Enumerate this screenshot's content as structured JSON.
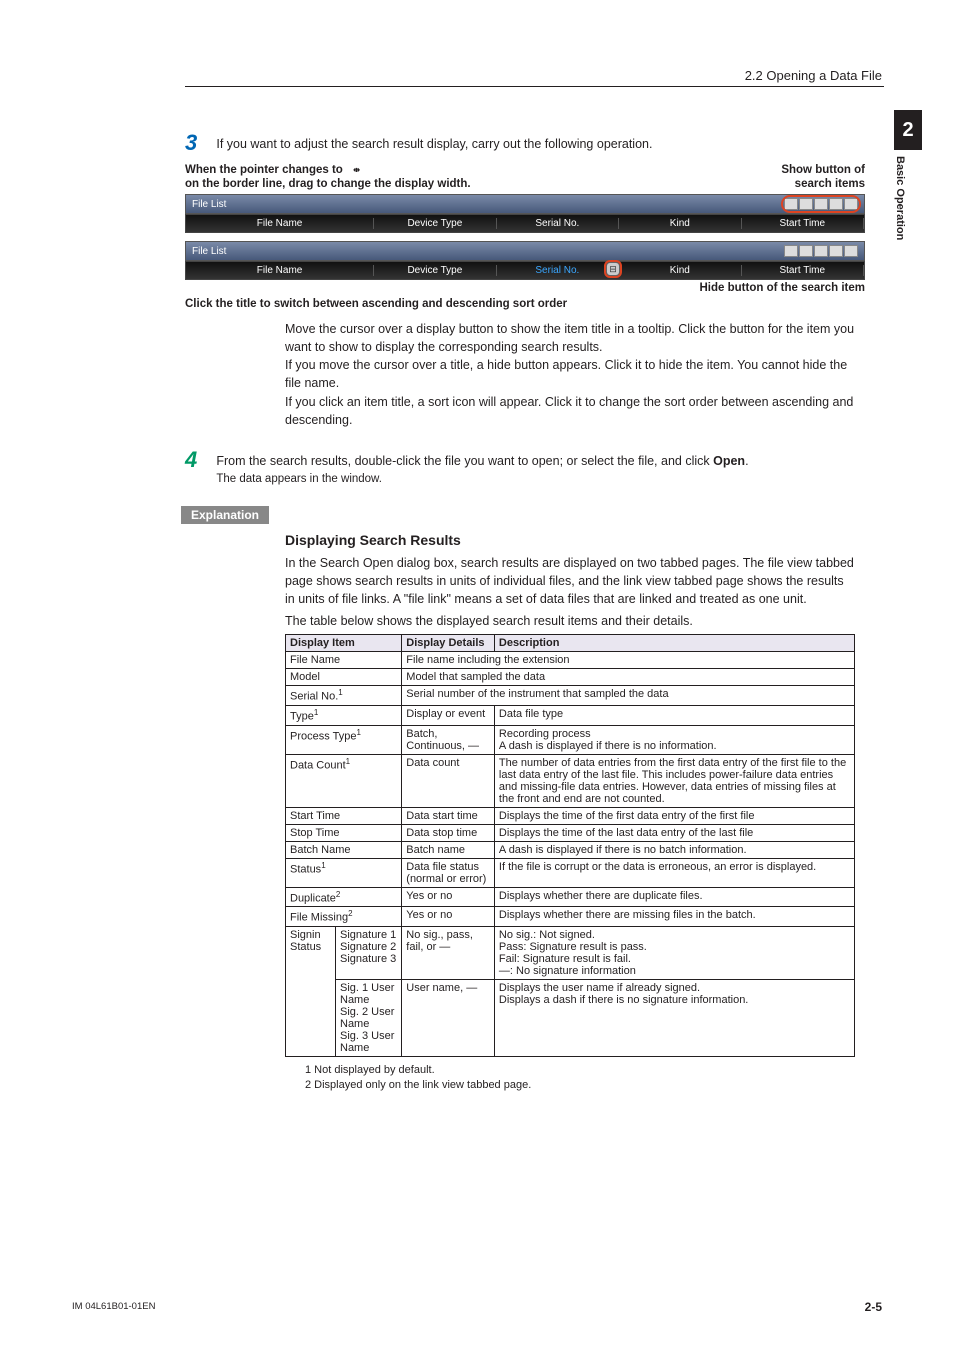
{
  "header": {
    "section": "2.2  Opening a Data File"
  },
  "sidebar": {
    "chapter_num": "2",
    "chapter_label": "Basic Operation"
  },
  "step3": {
    "num": "3",
    "text": "If you want to adjust the search result display, carry out the following operation.",
    "ann_left_l1": "When the pointer changes to",
    "ann_left_l2": "on the border line, drag to change the display width.",
    "ann_right_l1": "Show button of",
    "ann_right_l2": "search items",
    "file_list_label": "File List",
    "hdr": {
      "c1": "File Name",
      "c2": "Device Type",
      "c3": "Serial No.",
      "c4": "Kind",
      "c5": "Start Time"
    },
    "hide_caption": "Hide button of the search item",
    "sort_caption": "Click the title to switch between ascending and descending sort order",
    "para1": "Move the cursor over a display button to show the item title in a tooltip. Click the button for the item you want to show to display the corresponding search results.",
    "para2": "If you move the cursor over a title, a hide button appears. Click it to hide the item. You cannot hide the file name.",
    "para3": "If you click an item title, a sort icon will appear. Click it to change the sort order between ascending and descending."
  },
  "step4": {
    "num": "4",
    "text_a": "From the search results, double-click the file you want to open; or select the file, and click ",
    "text_b": "Open",
    "text_c": ".",
    "sub": "The data appears in the window."
  },
  "explanation": {
    "label": "Explanation",
    "title": "Displaying Search Results",
    "body1": "In the Search Open dialog box, search results are displayed on two tabbed pages. The file view tabbed page shows search results in units of individual files, and the link view tabbed page shows the results in units of file links. A \"file link\" means a set of data files that are linked and treated as one unit.",
    "body2": "The table below shows the displayed search result items and their details."
  },
  "table": {
    "head": {
      "c1": "Display Item",
      "c2": "Display Details",
      "c3": "Description"
    },
    "rows": [
      {
        "item": "File Name",
        "sup": "",
        "det": "File name including the extension",
        "desc": "",
        "span2": true
      },
      {
        "item": "Model",
        "sup": "",
        "det": "Model that sampled the data",
        "desc": "",
        "span2": true
      },
      {
        "item": "Serial No.",
        "sup": "1",
        "det": "Serial number of the instrument that sampled the data",
        "desc": "",
        "span2": true
      },
      {
        "item": "Type",
        "sup": "1",
        "det": "Display or event",
        "desc": "Data file type"
      },
      {
        "item": "Process Type",
        "sup": "1",
        "det": "Batch, Continuous, —",
        "desc": "Recording process\nA dash is displayed if there is no information."
      },
      {
        "item": "Data Count",
        "sup": "1",
        "det": "Data count",
        "desc": "The number of data entries from the first data entry of the first file to the last data entry of the last file. This includes power-failure data entries and missing-file data entries. However, data entries of missing files at the front and end are not counted."
      },
      {
        "item": "Start Time",
        "sup": "",
        "det": "Data start time",
        "desc": "Displays the time of the first data entry of the first file"
      },
      {
        "item": "Stop Time",
        "sup": "",
        "det": "Data stop time",
        "desc": "Displays the time of the last data entry of the last file"
      },
      {
        "item": "Batch Name",
        "sup": "",
        "det": "Batch name",
        "desc": "A dash is displayed if there is no batch information."
      },
      {
        "item": "Status",
        "sup": "1",
        "det": "Data file status (normal or error)",
        "desc": "If the file is corrupt or the data is erroneous, an error is displayed."
      },
      {
        "item": "Duplicate",
        "sup": "2",
        "det": "Yes or no",
        "desc": "Displays whether there are duplicate files."
      },
      {
        "item": "File Missing",
        "sup": "2",
        "det": "Yes or no",
        "desc": "Displays whether there are missing files in the batch."
      }
    ],
    "signin_row": {
      "left": "Signin Status",
      "sub1_item": "Signature 1\nSignature 2\nSignature 3",
      "sub1_det": "No sig., pass, fail, or —",
      "sub1_desc": "No sig.: Not signed.\nPass: Signature result is pass.\nFail: Signature result is fail.\n—: No signature information",
      "sub2_item": "Sig. 1 User Name\nSig. 2 User Name\nSig. 3 User Name",
      "sub2_det": "User name, —",
      "sub2_desc": "Displays the user name if already signed.\nDisplays a dash if there is no signature information."
    }
  },
  "footnotes": {
    "f1": "1   Not displayed by default.",
    "f2": "2   Displayed only on the link view tabbed page."
  },
  "footer": {
    "left": "IM 04L61B01-01EN",
    "right": "2-5"
  }
}
